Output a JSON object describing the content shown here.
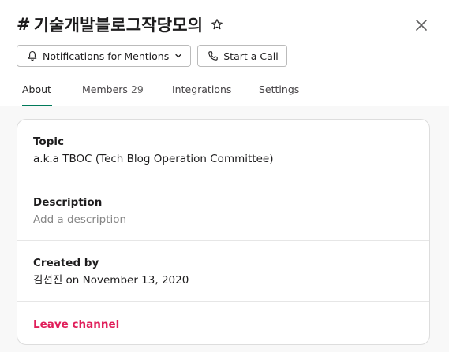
{
  "channel": {
    "hash": "#",
    "name": "기술개발블로그작당모의"
  },
  "buttons": {
    "notifications": "Notifications for Mentions",
    "call": "Start a Call"
  },
  "tabs": [
    {
      "label": "About",
      "active": true
    },
    {
      "label": "Members",
      "count": "29"
    },
    {
      "label": "Integrations"
    },
    {
      "label": "Settings"
    }
  ],
  "about": {
    "topic_label": "Topic",
    "topic_value": "a.k.a TBOC (Tech Blog Operation Committee)",
    "description_label": "Description",
    "description_placeholder": "Add a description",
    "created_label": "Created by",
    "created_value": "김선진 on November 13, 2020",
    "leave_label": "Leave channel"
  },
  "colors": {
    "accent_tab_underline": "#007a5a",
    "leave_text": "#e01e5a"
  },
  "icons": [
    "star-icon",
    "close-icon",
    "bell-icon",
    "chevron-down-icon",
    "phone-icon"
  ]
}
